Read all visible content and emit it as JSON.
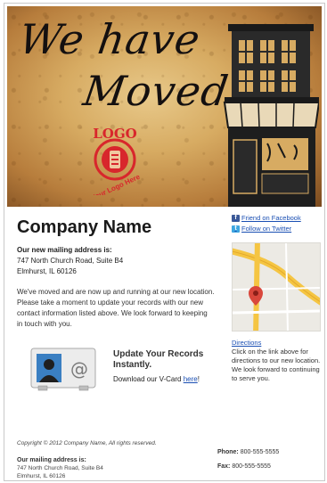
{
  "banner": {
    "line1": "We have",
    "line2": "Moved",
    "logo_text": "LOGO",
    "logo_sub": "Your Logo Here"
  },
  "company": {
    "name": "Company Name",
    "address_label": "Our new mailing address is:",
    "address_line1": "747 North Church Road, Suite B4",
    "address_line2": "Elmhurst, IL 60126",
    "message": "We've moved and are now up and running at our new location. Please take a moment to update your records with our new contact information listed above. We look forward to keeping in touch with you."
  },
  "vcard": {
    "title": "Update Your Records Instantly.",
    "line_prefix": "Download our V-Card ",
    "link_text": "here",
    "line_suffix": "!"
  },
  "social": {
    "facebook": "Friend on Facebook",
    "twitter": "Follow on Twitter"
  },
  "directions": {
    "link": "Directions",
    "text": "Click on the link above for directions to our new location. We look forward to continuing to serve you."
  },
  "footer": {
    "copyright": "Copyright © 2012 Company Name, All rights reserved.",
    "mail_label": "Our mailing address is:",
    "mail_line1": "747 North Church Road, Suite B4",
    "mail_line2": "Elmhurst, IL 60126",
    "phone_label": "Phone:",
    "phone": "800-555-5555",
    "fax_label": "Fax:",
    "fax": "800-555-5555"
  },
  "colors": {
    "link": "#1a4fb3",
    "logo_red": "#d8262c",
    "map_road": "#f5c542"
  },
  "icons": {
    "facebook": "facebook-icon",
    "twitter": "twitter-icon",
    "vcard": "vcard-icon",
    "map_pin": "map-pin-icon"
  }
}
